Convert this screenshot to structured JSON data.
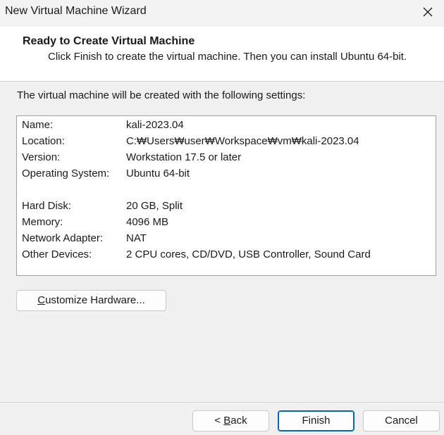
{
  "window": {
    "title": "New Virtual Machine Wizard"
  },
  "header": {
    "title": "Ready to Create Virtual Machine",
    "description": "Click Finish to create the virtual machine. Then you can install Ubuntu 64-bit."
  },
  "intro": "The virtual machine will be created with the following settings:",
  "settings": [
    {
      "label": "Name:",
      "value": "kali-2023.04"
    },
    {
      "label": "Location:",
      "value": "C:₩Users₩user₩Workspace₩vm₩kali-2023.04"
    },
    {
      "label": "Version:",
      "value": "Workstation 17.5 or later"
    },
    {
      "label": "Operating System:",
      "value": "Ubuntu 64-bit"
    },
    {
      "label": "Hard Disk:",
      "value": "20 GB, Split"
    },
    {
      "label": "Memory:",
      "value": "4096 MB"
    },
    {
      "label": "Network Adapter:",
      "value": "NAT"
    },
    {
      "label": "Other Devices:",
      "value": "2 CPU cores, CD/DVD, USB Controller, Sound Card"
    }
  ],
  "buttons": {
    "customize_mnemonic": "C",
    "customize_rest": "ustomize Hardware...",
    "back_prefix": "< ",
    "back_mnemonic": "B",
    "back_rest": "ack",
    "finish": "Finish",
    "cancel": "Cancel"
  },
  "icons": {
    "close": "close-icon"
  },
  "colors": {
    "primary_border": "#0067c0",
    "header_bg": "#ffffff",
    "body_bg": "#f0f0f0"
  }
}
